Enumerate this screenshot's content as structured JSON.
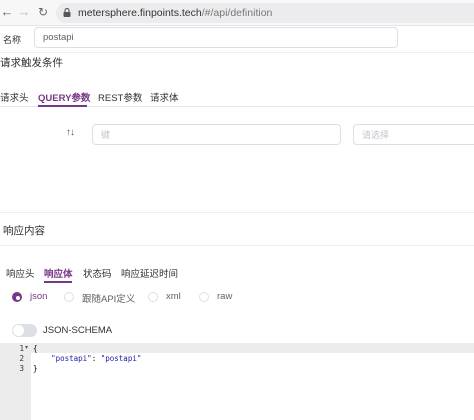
{
  "browser": {
    "url_host": "metersphere.finpoints.tech",
    "url_path": "/#/api/definition"
  },
  "form": {
    "name_label": "名称",
    "name_value": "postapi"
  },
  "request": {
    "section_title": "请求触发条件",
    "tabs": [
      {
        "label": "请求头",
        "active": false
      },
      {
        "label": "QUERY参数",
        "active": true
      },
      {
        "label": "REST参数",
        "active": false
      },
      {
        "label": "请求体",
        "active": false
      }
    ],
    "key_placeholder": "键",
    "select_placeholder": "请选择"
  },
  "response": {
    "section_title": "响应内容",
    "tabs": [
      {
        "label": "响应头",
        "active": false
      },
      {
        "label": "响应体",
        "active": true
      },
      {
        "label": "状态码",
        "active": false
      },
      {
        "label": "响应延迟时间",
        "active": false
      }
    ],
    "body_types": [
      {
        "label": "json",
        "checked": true
      },
      {
        "label": "跟随API定义",
        "checked": false
      },
      {
        "label": "xml",
        "checked": false
      },
      {
        "label": "raw",
        "checked": false
      }
    ],
    "json_schema_label": "JSON-SCHEMA",
    "json_schema_enabled": false
  },
  "editor": {
    "line_numbers": [
      "1",
      "2",
      "3"
    ],
    "lines": [
      {
        "text": "{"
      },
      {
        "key": "\"postapi\"",
        "sep": ": ",
        "value": "\"postapi\""
      },
      {
        "text": "}"
      }
    ]
  },
  "colors": {
    "accent": "#783887",
    "border": "#dcdfe6"
  }
}
